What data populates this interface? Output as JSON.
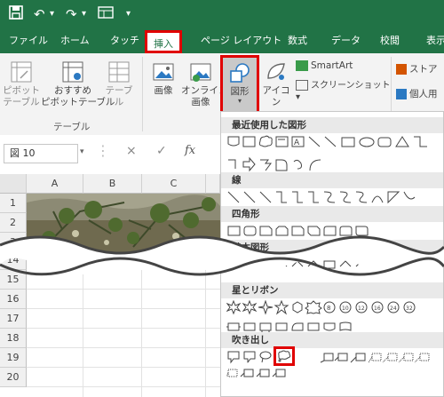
{
  "tabs": [
    "ファイル",
    "ホーム",
    "タッチ",
    "挿入",
    "ページ レイアウト",
    "数式",
    "データ",
    "校閲",
    "表示"
  ],
  "active_tab": "挿入",
  "ribbon": {
    "pivot": "ピボット\nテーブル",
    "recommended": "おすすめ\nピボットテーブル",
    "table": "テーブル",
    "group_table": "テーブル",
    "image": "画像",
    "online_image": "オンライン\n画像",
    "shapes": "図形",
    "icons": "アイコン",
    "smartart": "SmartArt",
    "screenshot": "スクリーンショット",
    "store": "ストア",
    "personal": "個人用"
  },
  "namebox": "図 10",
  "formula_icons": {
    "cancel": "×",
    "enter": "✓",
    "fx": "fx"
  },
  "columns": [
    "A",
    "B",
    "C"
  ],
  "rows_top": [
    "1",
    "2",
    "3"
  ],
  "rows_bottom": [
    "14",
    "15",
    "16",
    "17",
    "18",
    "19",
    "20"
  ],
  "sections": {
    "recent": "最近使用した図形",
    "lines": "線",
    "rect": "四角形",
    "basic": "基本図形",
    "stars": "星とリボン",
    "callouts": "吹き出し"
  }
}
